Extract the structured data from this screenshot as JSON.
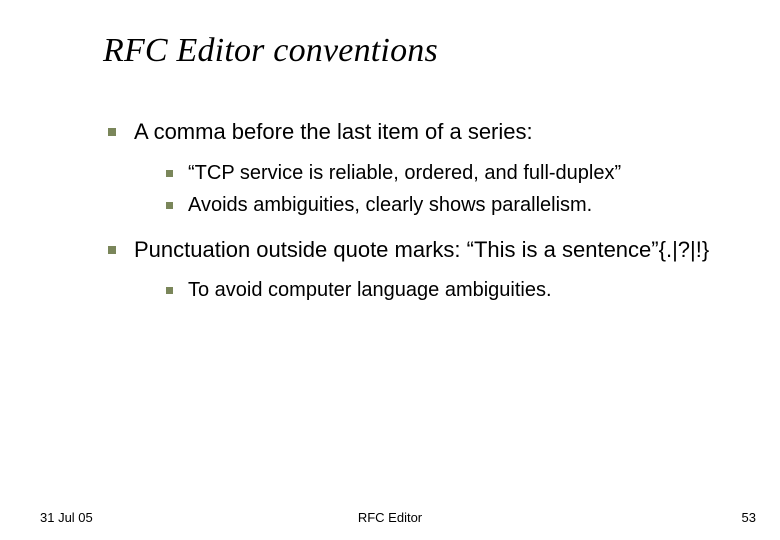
{
  "title": "RFC Editor conventions",
  "bullets": [
    {
      "text": "A comma before the last item of a series:",
      "children": [
        {
          "text": "“TCP service is reliable, ordered, and full-duplex”"
        },
        {
          "text": "Avoids ambiguities, clearly shows parallelism."
        }
      ]
    },
    {
      "text": "Punctuation outside quote marks: “This is a sentence”{.|?|!}",
      "children": [
        {
          "text": "To avoid computer language ambiguities."
        }
      ]
    }
  ],
  "footer": {
    "date": "31 Jul 05",
    "center": "RFC Editor",
    "page_number": "53"
  }
}
